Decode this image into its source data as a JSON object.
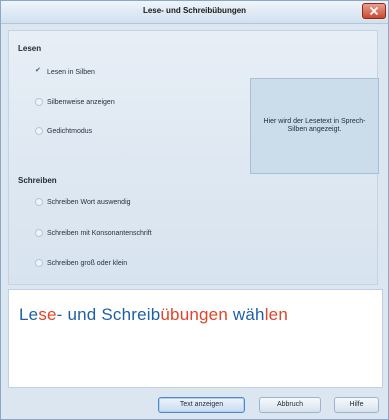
{
  "window": {
    "title": "Lese- und Schreibübungen"
  },
  "reading": {
    "heading": "Lesen",
    "options": [
      {
        "label": "Lesen in Silben",
        "selected": true
      },
      {
        "label": "Silbenweise anzeigen",
        "selected": false
      },
      {
        "label": "Gedichtmodus",
        "selected": false
      }
    ],
    "preview_text": "Hier wird der Lesetext in Sprech-Silben angezeigt."
  },
  "writing": {
    "heading": "Schreiben",
    "options": [
      {
        "label": "Schreiben Wort auswendig",
        "selected": false
      },
      {
        "label": "Schreiben mit Konsonantenschrift",
        "selected": false
      },
      {
        "label": "Schreiben groß oder klein",
        "selected": false
      }
    ]
  },
  "sample": {
    "segments": [
      {
        "text": "Le",
        "color": "#1f5fa8"
      },
      {
        "text": "se",
        "color": "#e0442a"
      },
      {
        "text": "- und Schreib",
        "color": "#1f5fa8"
      },
      {
        "text": "übun",
        "color": "#e0442a"
      },
      {
        "text": "gen",
        "color": "#e0442a"
      },
      {
        "text": " wäh",
        "color": "#1f5fa8"
      },
      {
        "text": "len",
        "color": "#e0442a"
      }
    ]
  },
  "buttons": {
    "show_text": "Text anzeigen",
    "cancel": "Abbruch",
    "help": "Hilfe"
  },
  "icons": {
    "close": "close-icon",
    "check": "check-icon"
  },
  "colors": {
    "blue_text": "#1f5fa8",
    "red_text": "#e0442a",
    "close_button": "#c84a31"
  }
}
